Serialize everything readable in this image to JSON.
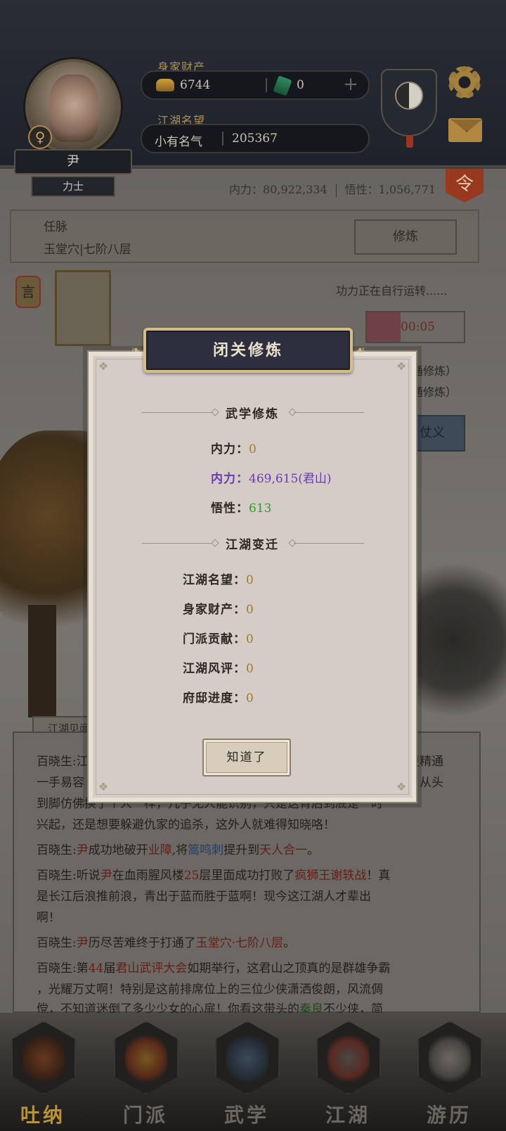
{
  "header": {
    "wealth_label": "身家财产",
    "wealth_gold": "6744",
    "wealth_jade": "0",
    "plus": "+",
    "fame_label": "江湖名望",
    "fame_title": "小有名气",
    "fame_value": "205367",
    "player_name": "尹",
    "player_rank": "力士",
    "gender_symbol": "♀"
  },
  "stats": {
    "neili_label": "内力：",
    "neili_value": "80,922,334",
    "wuxing_label": "悟性：",
    "wuxing_value": "1,056,771",
    "order_icon": "令"
  },
  "meridian": {
    "title": "任脉",
    "sub": "玉堂穴|七阶八层",
    "train_button": "修炼"
  },
  "side": {
    "yan_tag": "言",
    "running_text": "功力正在自行运转......",
    "timer": "00:05",
    "line1": "普通修炼）",
    "line2": "普通修炼）",
    "blue_button": "仗义"
  },
  "dialog": {
    "title": "闭关修炼",
    "section1": "武学修炼",
    "rows1": [
      {
        "k": "内力：",
        "v": "0"
      },
      {
        "k": "内力：",
        "v": "469,615(君山)"
      },
      {
        "k": "悟性：",
        "v": "613"
      }
    ],
    "section2": "江湖变迁",
    "rows2": [
      {
        "k": "江湖名望：",
        "v": "0"
      },
      {
        "k": "身家财产：",
        "v": "0"
      },
      {
        "k": "门派贡献：",
        "v": "0"
      },
      {
        "k": "江湖风评：",
        "v": "0"
      },
      {
        "k": "府邸进度：",
        "v": "0"
      }
    ],
    "ok_button": "知道了"
  },
  "log": {
    "tab": "江湖见闻",
    "lines": [
      {
        "a": "百晓生:",
        "b": "江湖上传说",
        "c": "",
        "d": "更精通"
      },
      {
        "a": "一手易容",
        "b": "",
        "c": "",
        "d": "，从头"
      },
      {
        "a": "到脚仿佛换了个人一样，几乎无人能识别，只是这背后到底是一时",
        "b": "",
        "c": "",
        "d": ""
      },
      {
        "a": "兴起，还是想要躲避仇家的追杀，这外人就难得知晓咯！",
        "b": "",
        "c": "",
        "d": ""
      }
    ],
    "e1_a": "百晓生:",
    "e1_name": "尹",
    "e1_b": "成功地破开",
    "e1_c": "业障",
    "e1_d": ",将",
    "e1_skill": "篙鸣刺",
    "e1_e": "提升到",
    "e1_level": "天人合一",
    "e1_f": "。",
    "e2_a": "百晓生:听说",
    "e2_name": "尹",
    "e2_b": "在血雨腥风楼",
    "e2_floor": "25",
    "e2_c": "层里面成功打败了",
    "e2_boss": "疯狮王谢轶战",
    "e2_d": "！真",
    "e2_line2": "是长江后浪推前浪，青出于蓝而胜于蓝啊！现今这江湖人才辈出",
    "e2_line3": "啊！",
    "e3_a": "百晓生:",
    "e3_name": "尹",
    "e3_b": "历尽苦难终于打通了",
    "e3_point": "玉堂穴·七阶八层",
    "e3_c": "。",
    "e4_a": "百晓生:第",
    "e4_num": "44",
    "e4_b": "届",
    "e4_event": "君山武评大会",
    "e4_c": "如期举行，这君山之顶真的是群雄争霸",
    "e4_line2": "，光耀万丈啊！特别是这前排席位上的三位少侠潇洒俊朗，风流倜",
    "e4_line3": "傥，不知道迷倒了多少少女的心扉！你看这带头的",
    "e4_hero": "秦良",
    "e4_d": "不少侠，简"
  },
  "nav": [
    {
      "label": "吐纳",
      "active": true
    },
    {
      "label": "门派",
      "active": false
    },
    {
      "label": "武学",
      "active": false
    },
    {
      "label": "江湖",
      "active": false
    },
    {
      "label": "游历",
      "active": false
    }
  ],
  "colors": {
    "gold_value": "#9a7d2f",
    "purple_value": "#6a3ab0",
    "green_value": "#2f9a2c",
    "header_bg": "#2d2f3e",
    "header_border": "#d6bd83"
  }
}
